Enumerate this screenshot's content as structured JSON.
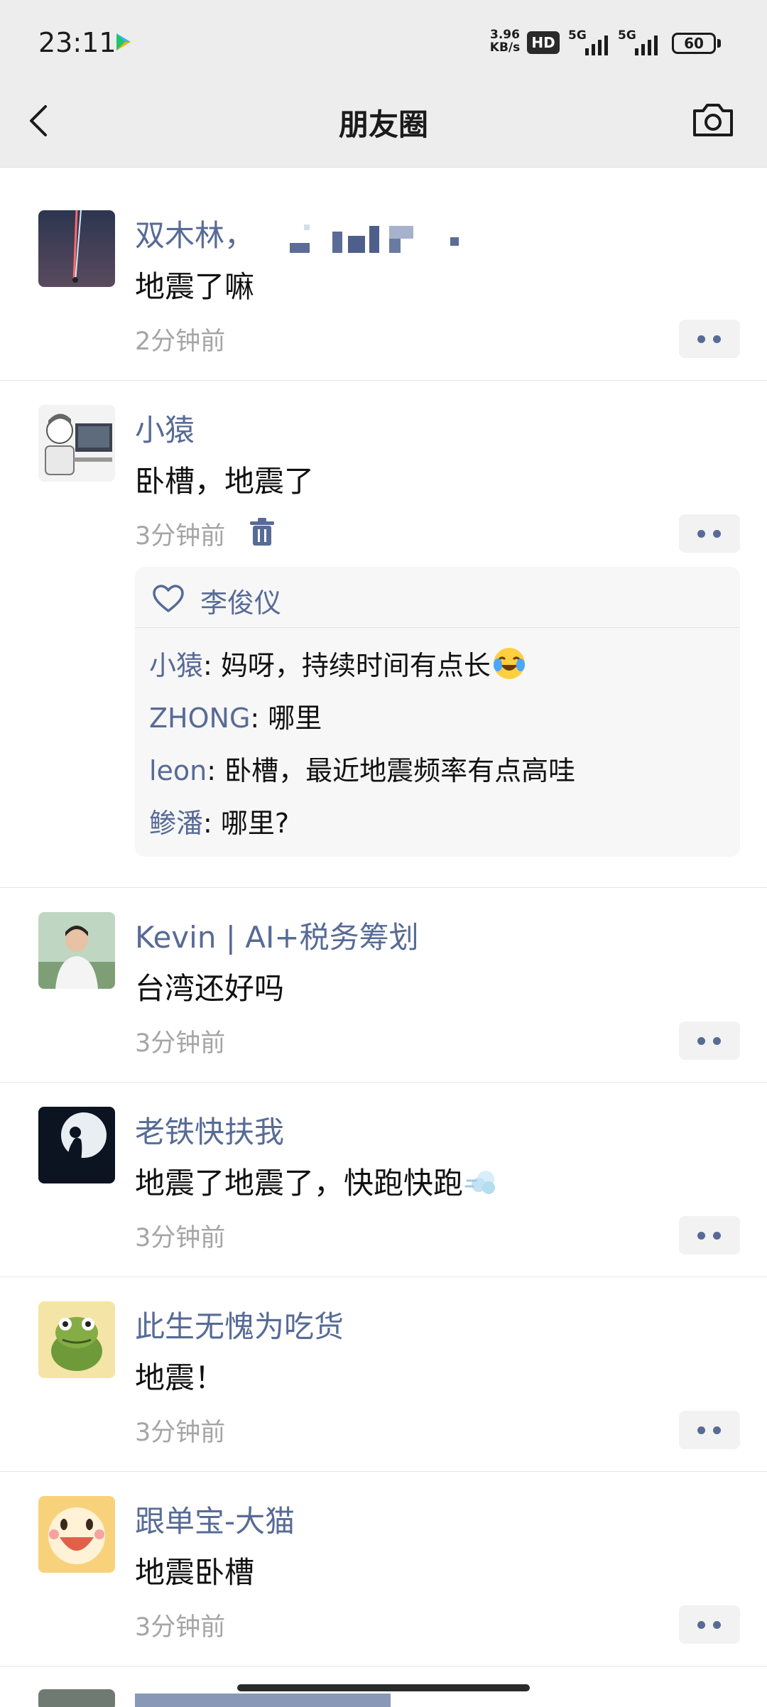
{
  "status_bar": {
    "time": "23:11",
    "net_speed_value": "3.96",
    "net_speed_unit": "KB/s",
    "hd": "HD",
    "signal1": "5G",
    "signal2": "5G",
    "battery": "60"
  },
  "header": {
    "title": "朋友圈",
    "back_icon": "chevron-left-icon",
    "camera_icon": "camera-icon"
  },
  "notifications": [
    {
      "name": "双木林，",
      "content": "地震了嘛",
      "time": "2分钟前"
    },
    {
      "name": "小猿",
      "content": "卧槽，地震了",
      "time": "3分钟前"
    },
    {
      "name": "Kevin | AI+税务筹划",
      "content": "台湾还好吗",
      "time": "3分钟前"
    },
    {
      "name": "老铁快扶我",
      "content": "地震了地震了，快跑快跑",
      "time": "3分钟前"
    },
    {
      "name": "此生无愧为吃货",
      "content": "地震！",
      "time": "3分钟前"
    },
    {
      "name": "跟单宝-大猫",
      "content": "地震卧槽",
      "time": "3分钟前"
    }
  ],
  "post_interactions": {
    "likes": "李俊仪",
    "comments": [
      {
        "author": "小猿",
        "text": ": 妈呀，持续时间有点长"
      },
      {
        "author": "ZHONG",
        "text": ": 哪里"
      },
      {
        "author": "leon",
        "text": ": 卧槽，最近地震频率有点高哇"
      },
      {
        "author": "鲹潘",
        "text": ": 哪里?"
      }
    ]
  },
  "colors": {
    "link": "#576b95",
    "header_bg": "#ededed",
    "time_gray": "#a5a5a5"
  }
}
